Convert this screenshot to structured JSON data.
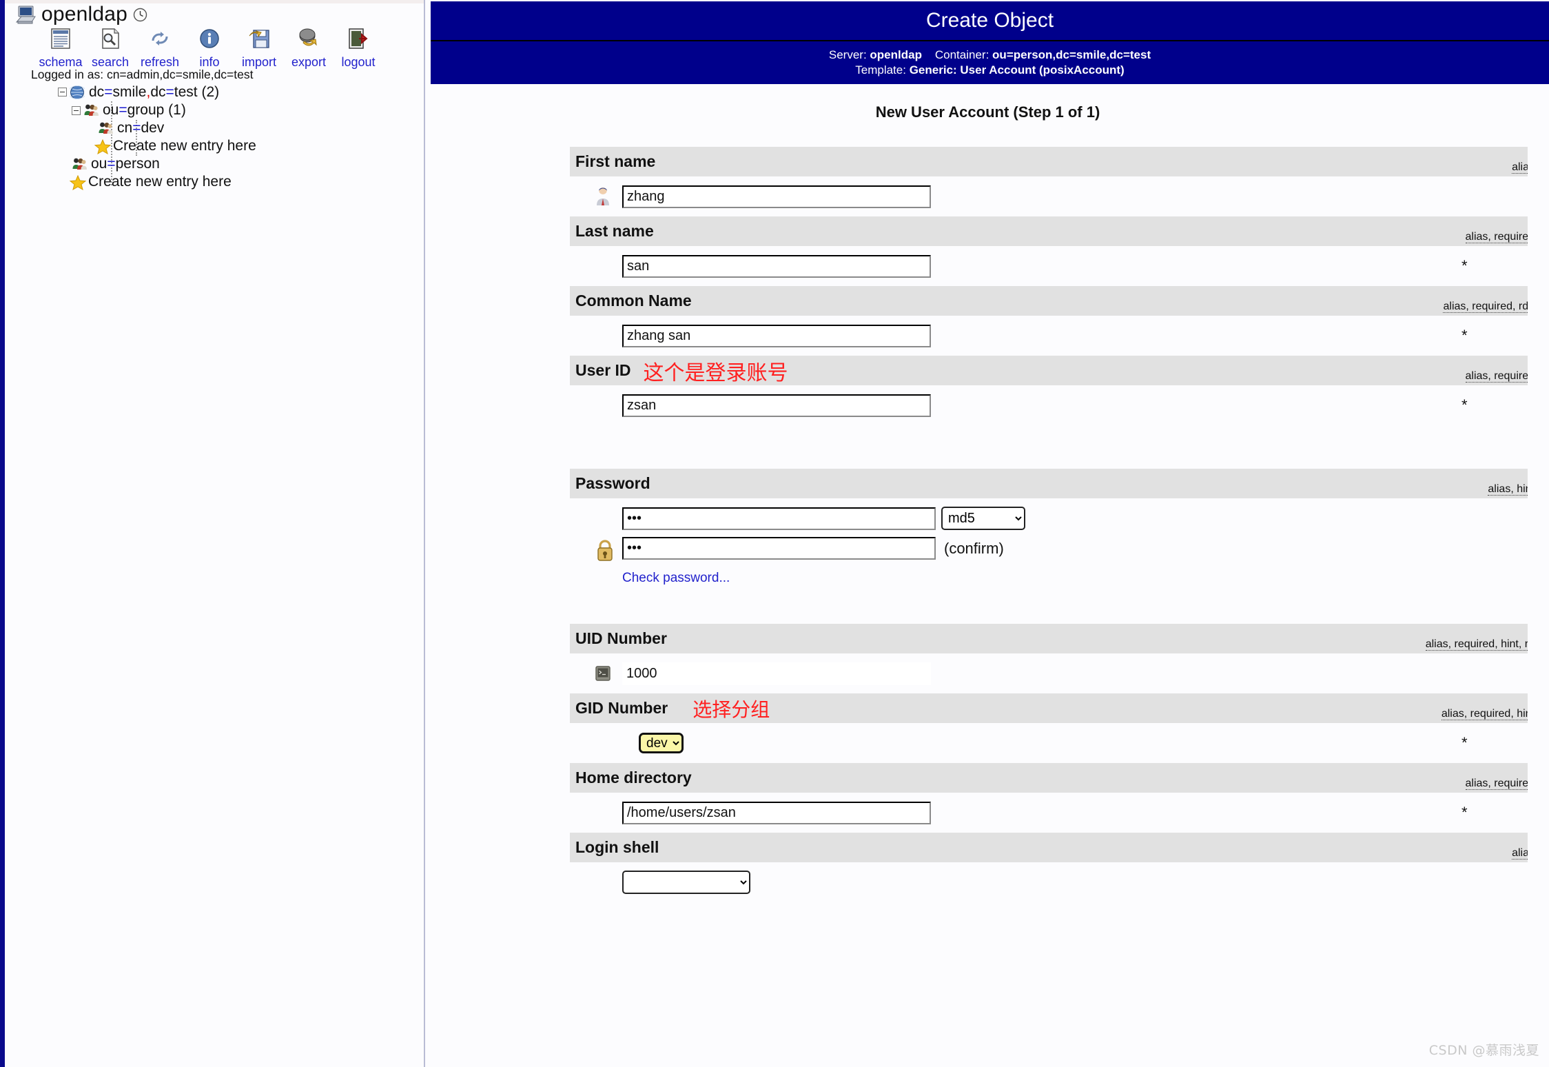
{
  "sidebar": {
    "brand": {
      "title": "openldap",
      "pc_icon": "computer-icon",
      "clock_icon": "clock-icon"
    },
    "toolbar": [
      {
        "label": "schema",
        "icon": "schema-document-icon"
      },
      {
        "label": "search",
        "icon": "search-document-icon"
      },
      {
        "label": "refresh",
        "icon": "refresh-arrows-icon"
      },
      {
        "label": "info",
        "icon": "info-circle-icon"
      },
      {
        "label": "import",
        "icon": "import-floppy-icon"
      },
      {
        "label": "export",
        "icon": "export-disk-icon"
      },
      {
        "label": "logout",
        "icon": "logout-door-icon"
      }
    ],
    "logged_in_as": "Logged in as: cn=admin,dc=smile,dc=test",
    "tree": [
      {
        "label_pre": "dc",
        "label_mid": "smile",
        "label_post": "dc",
        "label_post2": "test",
        "count": "(2)",
        "icon": "globe-icon"
      },
      {
        "label": "ou=group (1)",
        "icon": "group-people-icon"
      },
      {
        "label": "cn=dev",
        "icon": "group-people-icon"
      },
      {
        "label": "Create new entry here",
        "icon": "star-icon"
      },
      {
        "label": "ou=person",
        "icon": "group-people-icon"
      },
      {
        "label": "Create new entry here",
        "icon": "star-icon"
      }
    ],
    "tree_text": {
      "root": "dc=smile,dc=test (2)",
      "group": "ou=group (1)",
      "cn_dev": "cn=dev",
      "create1": "Create new entry here",
      "person": "ou=person",
      "create2": "Create new entry here"
    }
  },
  "header": {
    "title": "Create Object",
    "server_label": "Server:",
    "server_value": "openldap",
    "container_label": "Container:",
    "container_value": "ou=person,dc=smile,dc=test",
    "template_label": "Template:",
    "template_value": "Generic: User Account (posixAccount)"
  },
  "step_title": "New User Account (Step 1 of 1)",
  "fields": {
    "first_name": {
      "label": "First name",
      "hints": "alias",
      "value": "zhang",
      "icon": "person-icon",
      "required_star": ""
    },
    "last_name": {
      "label": "Last name",
      "hints": "alias, required",
      "value": "san",
      "required_star": "*"
    },
    "common_name": {
      "label": "Common Name",
      "hints": "alias, required, rdn",
      "value": "zhang san",
      "required_star": "*"
    },
    "user_id": {
      "label": "User ID",
      "annotation": "这个是登录账号",
      "hints": "alias, required",
      "value": "zsan",
      "required_star": "*"
    },
    "password": {
      "label": "Password",
      "hints": "alias, hint",
      "value": "•••",
      "confirm_value": "•••",
      "confirm_label": "(confirm)",
      "hash_selected": "md5",
      "hash_options": [
        "md5"
      ],
      "check_link": "Check password...",
      "icon": "lock-icon"
    },
    "uid_number": {
      "label": "UID Number",
      "hints": "alias, required, hint, ro",
      "value": "1000",
      "icon": "terminal-icon"
    },
    "gid_number": {
      "label": "GID Number",
      "annotation": "选择分组",
      "hints": "alias, required, hint",
      "selected": "dev",
      "options": [
        "dev"
      ],
      "required_star": "*"
    },
    "home_directory": {
      "label": "Home directory",
      "hints": "alias, required",
      "value": "/home/users/zsan",
      "required_star": "*"
    },
    "login_shell": {
      "label": "Login shell",
      "hints": "alias",
      "selected": "",
      "options": [
        ""
      ]
    }
  },
  "watermark": "CSDN @慕雨浅夏",
  "colors": {
    "header_blue": "#00008b",
    "row_gray": "#e1e1e1",
    "link_blue": "#2222cc",
    "annotation_red": "#ff2020",
    "autofill_yellow": "#faf6a8"
  }
}
